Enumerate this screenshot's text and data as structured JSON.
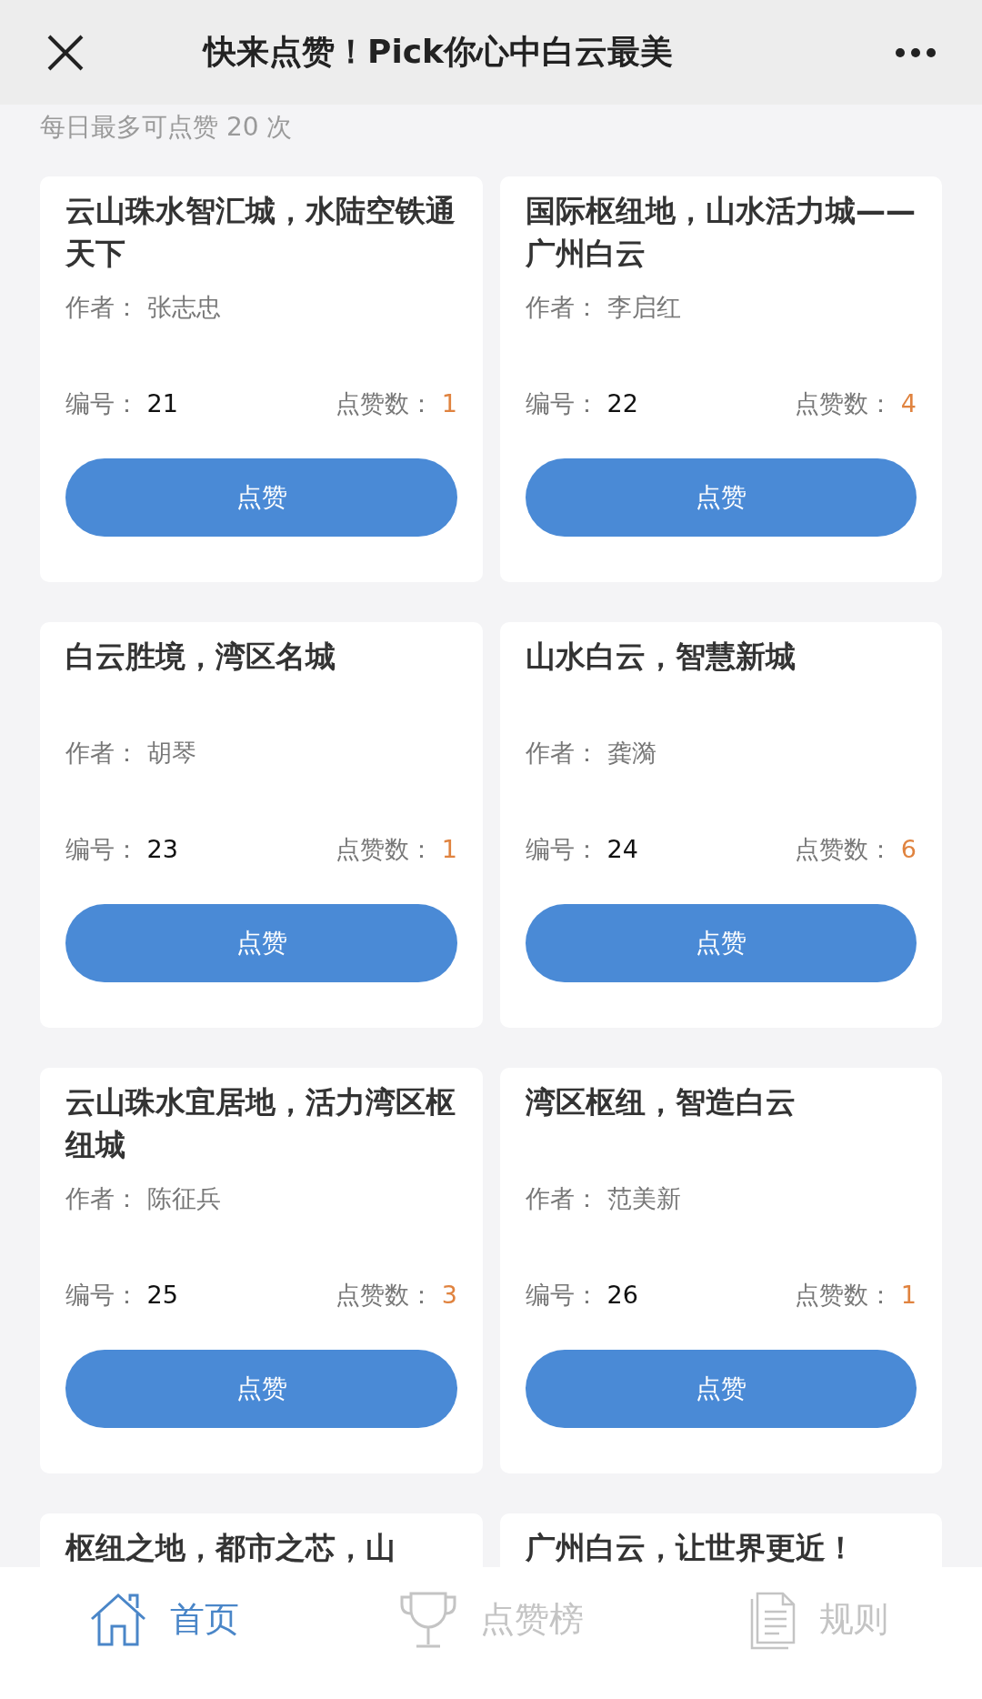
{
  "header": {
    "title": "快来点赞！Pick你心中白云最美"
  },
  "notice": "每日最多可点赞 20 次",
  "entries": [
    {
      "title": "云山珠水智汇城，水陆空铁通天下",
      "author_label": "作者：",
      "author": "张志忠",
      "number_label": "编号：",
      "number": "21",
      "likes_label": "点赞数：",
      "likes": "1",
      "button": "点赞"
    },
    {
      "title": "国际枢纽地，山水活力城——广州白云",
      "author_label": "作者：",
      "author": "李启红",
      "number_label": "编号：",
      "number": "22",
      "likes_label": "点赞数：",
      "likes": "4",
      "button": "点赞"
    },
    {
      "title": "白云胜境，湾区名城",
      "author_label": "作者：",
      "author": "胡琴",
      "number_label": "编号：",
      "number": "23",
      "likes_label": "点赞数：",
      "likes": "1",
      "button": "点赞"
    },
    {
      "title": "山水白云，智慧新城",
      "author_label": "作者：",
      "author": "龚漪",
      "number_label": "编号：",
      "number": "24",
      "likes_label": "点赞数：",
      "likes": "6",
      "button": "点赞"
    },
    {
      "title": "云山珠水宜居地，活力湾区枢纽城",
      "author_label": "作者：",
      "author": "陈征兵",
      "number_label": "编号：",
      "number": "25",
      "likes_label": "点赞数：",
      "likes": "3",
      "button": "点赞"
    },
    {
      "title": "湾区枢纽，智造白云",
      "author_label": "作者：",
      "author": "范美新",
      "number_label": "编号：",
      "number": "26",
      "likes_label": "点赞数：",
      "likes": "1",
      "button": "点赞"
    },
    {
      "title": "枢纽之地，都市之芯，山"
    },
    {
      "title": "广州白云，让世界更近！"
    }
  ],
  "tabs": [
    {
      "kind": "home",
      "label": "首页",
      "selected": true
    },
    {
      "kind": "trophy",
      "label": "点赞榜",
      "selected": false
    },
    {
      "kind": "document",
      "label": "规则",
      "selected": false
    }
  ]
}
